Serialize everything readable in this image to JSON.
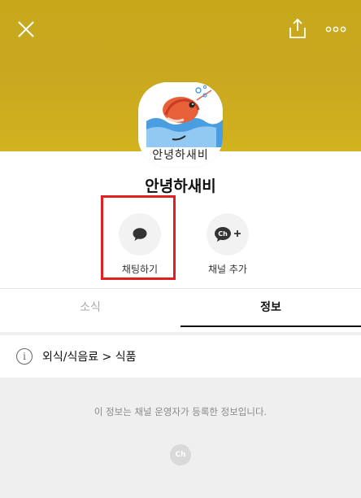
{
  "header": {
    "close_icon": "close-icon",
    "share_icon": "share-icon",
    "more_icon": "more-icon",
    "background_color": "#c9a720"
  },
  "profile": {
    "avatar_caption": "안녕하새비",
    "channel_name": "안녕하새비"
  },
  "actions": {
    "chat_label": "채팅하기",
    "add_channel_label": "채널 추가",
    "add_channel_icon_text": "Ch"
  },
  "tabs": [
    {
      "label": "소식",
      "active": false
    },
    {
      "label": "정보",
      "active": true
    }
  ],
  "info": {
    "category": "외식/식음료 > 식품",
    "note": "이 정보는 채널 운영자가 등록한 정보입니다.",
    "footer_logo_text": "Ch"
  },
  "colors": {
    "highlight": "#e02020",
    "accent_text": "#111111"
  }
}
